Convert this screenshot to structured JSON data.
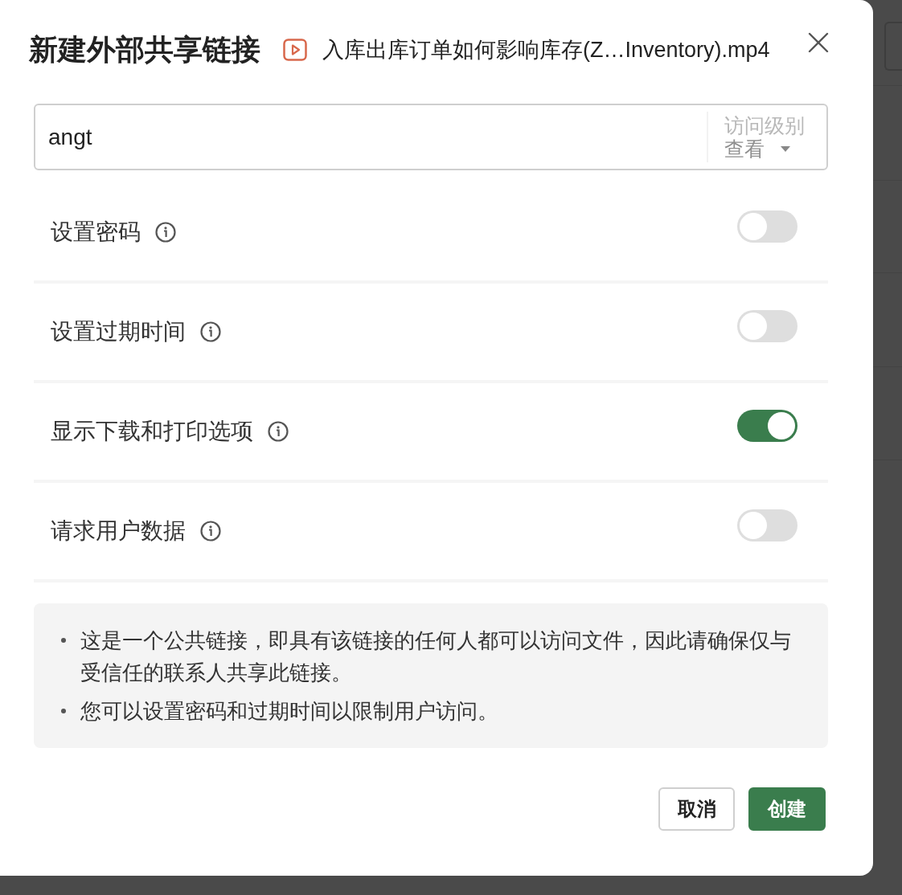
{
  "dialog": {
    "title": "新建外部共享链接",
    "file_name": "入库出库订单如何影响库存(Z…Inventory).mp4"
  },
  "recipient_field": {
    "value": "angt",
    "access_level": {
      "label": "访问级别",
      "value": "查看"
    }
  },
  "options": [
    {
      "label": "设置密码",
      "on": false
    },
    {
      "label": "设置过期时间",
      "on": false
    },
    {
      "label": "显示下载和打印选项",
      "on": true
    },
    {
      "label": "请求用户数据",
      "on": false
    }
  ],
  "notes": [
    "这是一个公共链接，即具有该链接的任何人都可以访问文件，因此请确保仅与受信任的联系人共享此链接。",
    "您可以设置密码和过期时间以限制用户访问。"
  ],
  "buttons": [
    {
      "label": "取消",
      "kind": "secondary"
    },
    {
      "label": "创建",
      "kind": "primary"
    }
  ]
}
